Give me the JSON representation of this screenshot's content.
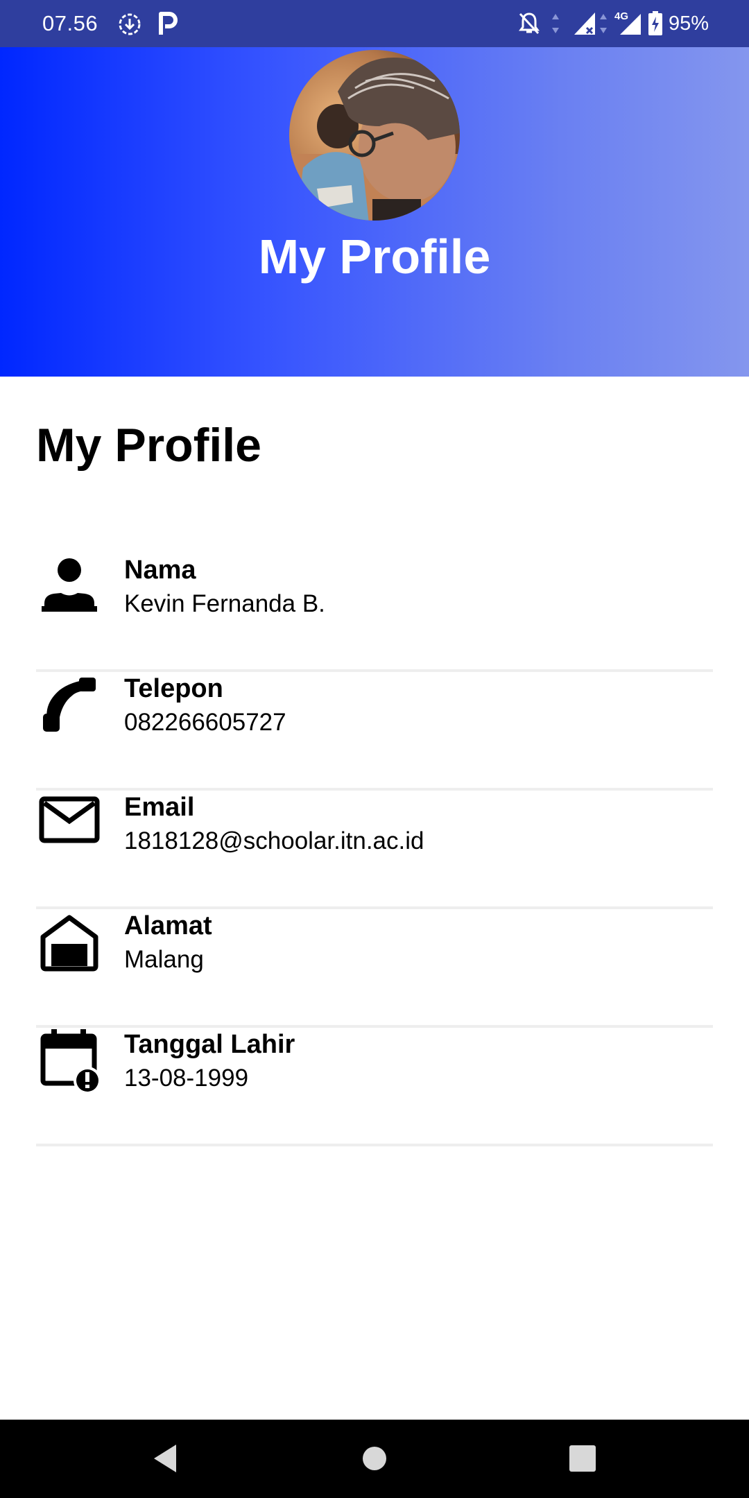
{
  "status_bar": {
    "time": "07.56",
    "battery": "95%",
    "network": "4G",
    "icons": [
      "download-icon",
      "parking-icon",
      "notifications-off-icon",
      "signal-icon",
      "signal-4g-icon",
      "battery-charging-icon"
    ]
  },
  "header": {
    "avatar_alt": "profile photo",
    "title": "My Profile",
    "gradient_colors": [
      "#0027ff",
      "#3553ff",
      "#6a80f2",
      "#8496ee"
    ]
  },
  "main": {
    "title": "My Profile",
    "items": [
      {
        "icon": "person-icon",
        "label": "Nama",
        "value": "Kevin Fernanda B."
      },
      {
        "icon": "phone-icon",
        "label": "Telepon",
        "value": "082266605727"
      },
      {
        "icon": "email-icon",
        "label": "Email",
        "value": "1818128@schoolar.itn.ac.id"
      },
      {
        "icon": "home-icon",
        "label": "Alamat",
        "value": "Malang"
      },
      {
        "icon": "calendar-alert-icon",
        "label": "Tanggal Lahir",
        "value": "13-08-1999"
      }
    ]
  },
  "nav_bar": {
    "buttons": [
      "back-button",
      "home-button",
      "recents-button"
    ]
  }
}
